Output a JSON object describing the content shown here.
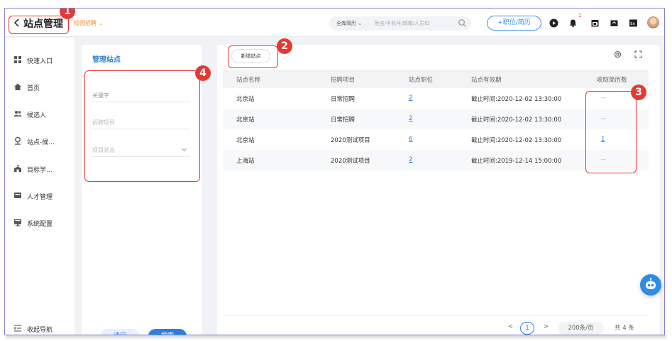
{
  "header": {
    "title": "站点管理",
    "channel": "校园招聘",
    "search_scope": "全库简历",
    "search_placeholder": "姓名/手机号/邮箱/人员ID",
    "add_position_label": "+职位/简历",
    "notification_badge": "1"
  },
  "sidebar": {
    "items": [
      {
        "label": "快速入口",
        "icon": "grid-icon"
      },
      {
        "label": "首页",
        "icon": "home-icon"
      },
      {
        "label": "候选人",
        "icon": "people-icon"
      },
      {
        "label": "站点-候...",
        "icon": "location-icon"
      },
      {
        "label": "目标学...",
        "icon": "school-icon"
      },
      {
        "label": "人才管理",
        "icon": "talent-icon"
      },
      {
        "label": "系统配置",
        "icon": "monitor-icon"
      }
    ],
    "collapse_label": "收起导航"
  },
  "filter": {
    "title": "管理站点",
    "keyword_placeholder": "关键字",
    "project_placeholder": "招聘项目",
    "status_placeholder": "项目状态",
    "clear_label": "清空",
    "search_label": "搜索"
  },
  "main": {
    "new_site_label": "新增站点",
    "columns": [
      "站点名称",
      "招聘项目",
      "站点职位",
      "站点有效期",
      "收取简历数"
    ],
    "rows": [
      {
        "name": "北京站",
        "project": "日常招聘",
        "positions": "2",
        "validity": "截止时间:2020-12-02 13:30:00",
        "resumes": "--"
      },
      {
        "name": "北京站",
        "project": "日常招聘",
        "positions": "2",
        "validity": "截止时间:2020-12-02 13:30:00",
        "resumes": "--"
      },
      {
        "name": "北京站",
        "project": "2020测试项目",
        "positions": "6",
        "validity": "截止时间:2020-12-02 13:30:00",
        "resumes": "1"
      },
      {
        "name": "上海站",
        "project": "2020测试项目",
        "positions": "2",
        "validity": "截止时间:2019-12-14 15:00:00",
        "resumes": "--"
      }
    ],
    "pagination": {
      "prev": "<",
      "current_page": "1",
      "next": ">",
      "page_size": "200条/页",
      "total": "共 4 条"
    }
  },
  "annotations": {
    "labels": [
      "1",
      "2",
      "3",
      "4"
    ],
    "color": "#e53935"
  },
  "colors": {
    "accent": "#2e7fdc",
    "channel_orange": "#f08a24",
    "annotation_red": "#e53935"
  }
}
